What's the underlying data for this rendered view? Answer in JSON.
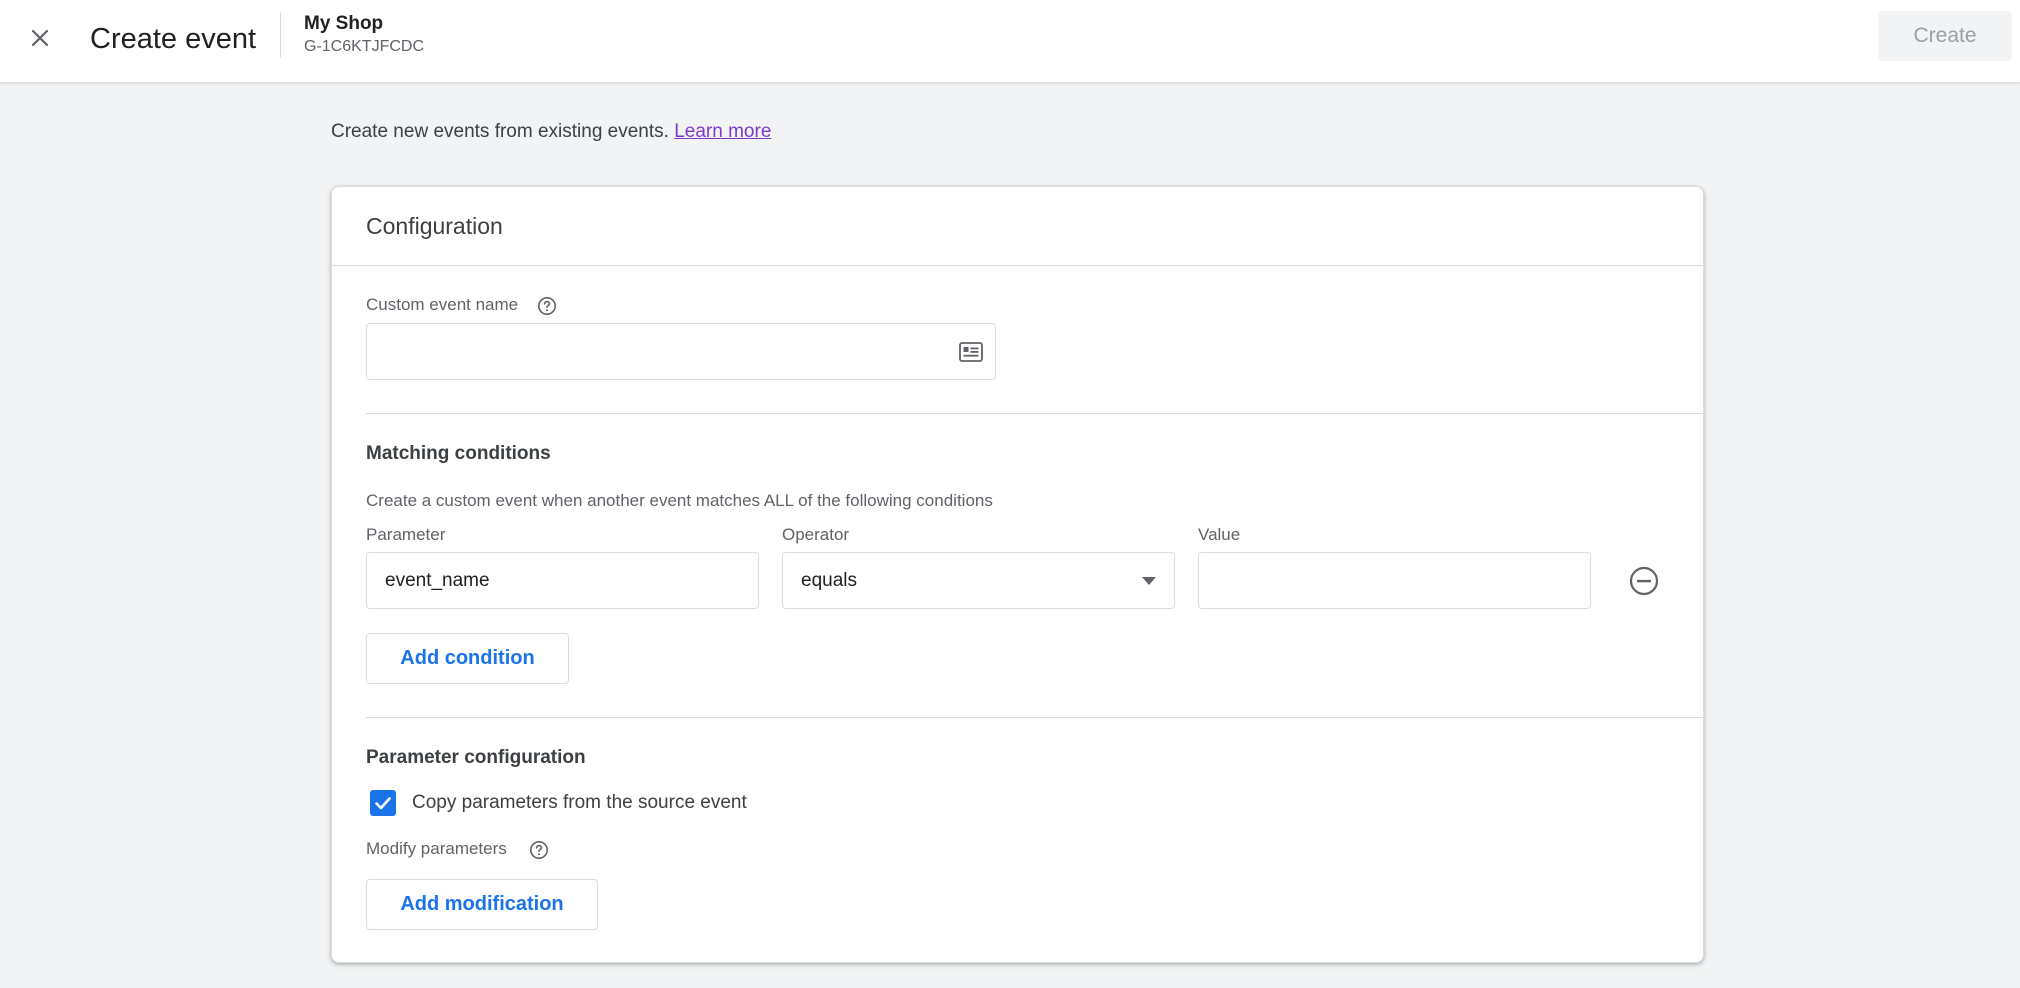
{
  "header": {
    "close_icon": "close-icon",
    "title": "Create event",
    "property_name": "My Shop",
    "property_id": "G-1C6KTJFCDC",
    "create_label": "Create"
  },
  "intro": {
    "text": "Create new events from existing events.",
    "link_text": "Learn more"
  },
  "config": {
    "title": "Configuration",
    "custom_event_name": {
      "label": "Custom event name",
      "value": "",
      "help_icon": "help-circle-icon",
      "trailing_icon": "id-card-icon"
    },
    "matching": {
      "title": "Matching conditions",
      "description": "Create a custom event when another event matches ALL of the following conditions",
      "headers": {
        "parameter": "Parameter",
        "operator": "Operator",
        "value": "Value"
      },
      "condition": {
        "parameter": "event_name",
        "operator": "equals",
        "value": ""
      },
      "remove_icon": "remove-circle-icon",
      "add_condition_label": "Add condition"
    },
    "parameter_config": {
      "title": "Parameter configuration",
      "copy_label": "Copy parameters from the source event",
      "copy_checked": true,
      "modify_label": "Modify parameters",
      "add_modification_label": "Add modification"
    }
  },
  "colors": {
    "accent": "#1a73e8",
    "link": "#7e3ac6",
    "background": "#f1f3f4"
  }
}
